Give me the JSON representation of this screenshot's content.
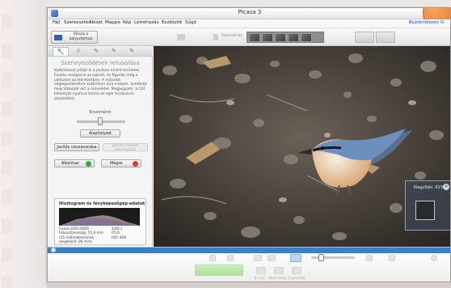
{
  "window": {
    "title": "Picasa 3"
  },
  "menu": {
    "items": [
      "Fájl",
      "Szerkesztés",
      "Nézet",
      "Mappa",
      "Kép",
      "Létrehozás",
      "Eszközök",
      "Súgó"
    ],
    "signin": "Bejelentkezés G"
  },
  "toolbar": {
    "back_label": "Vissza a könyvtárhoz",
    "caption_placeholder": "Képaláírás"
  },
  "panel": {
    "title": "Szennyeződések retusálása",
    "description": "Kattintással jelölje ki a javítani kívánt területet. Ezután mozgassa az egeret, és figyelje meg a változást az előnézetben. A művelet véglegesítéséhez kattintson újra a képre. Ismételje meg többször ezt a műveletet. Megjegyzés: a Ctrl billentyűt nyomva tartva az egér húzásával pásztázhat.",
    "slider_label": "Ecsetméret",
    "reset_button": "Alaphelyzet",
    "undo_button": "Javítás visszavonása",
    "redo_button": "Javítás ismételt alkalmazása",
    "apply_button": "Alkalmaz",
    "cancel_button": "Mégse"
  },
  "histogram": {
    "title": "Hisztogram és fényképezőgép-adatok",
    "exif_left": [
      "Canon EOS 600D",
      "Fókusztávolság: 55,0 mm",
      "(35 milliméteresnek",
      "megfelelő: 88 mm)"
    ],
    "exif_right": [
      "1/60 s",
      "f/5,6",
      "ISO: 800"
    ]
  },
  "navigator": {
    "label": "Nagyítás: 41%",
    "close": "×"
  },
  "bottom": {
    "labels": [
      "E-mail",
      "Nyomtatás",
      "Exportálás"
    ]
  },
  "colors": {
    "accent": "#3c7fc7",
    "orange": "#e3681b"
  }
}
